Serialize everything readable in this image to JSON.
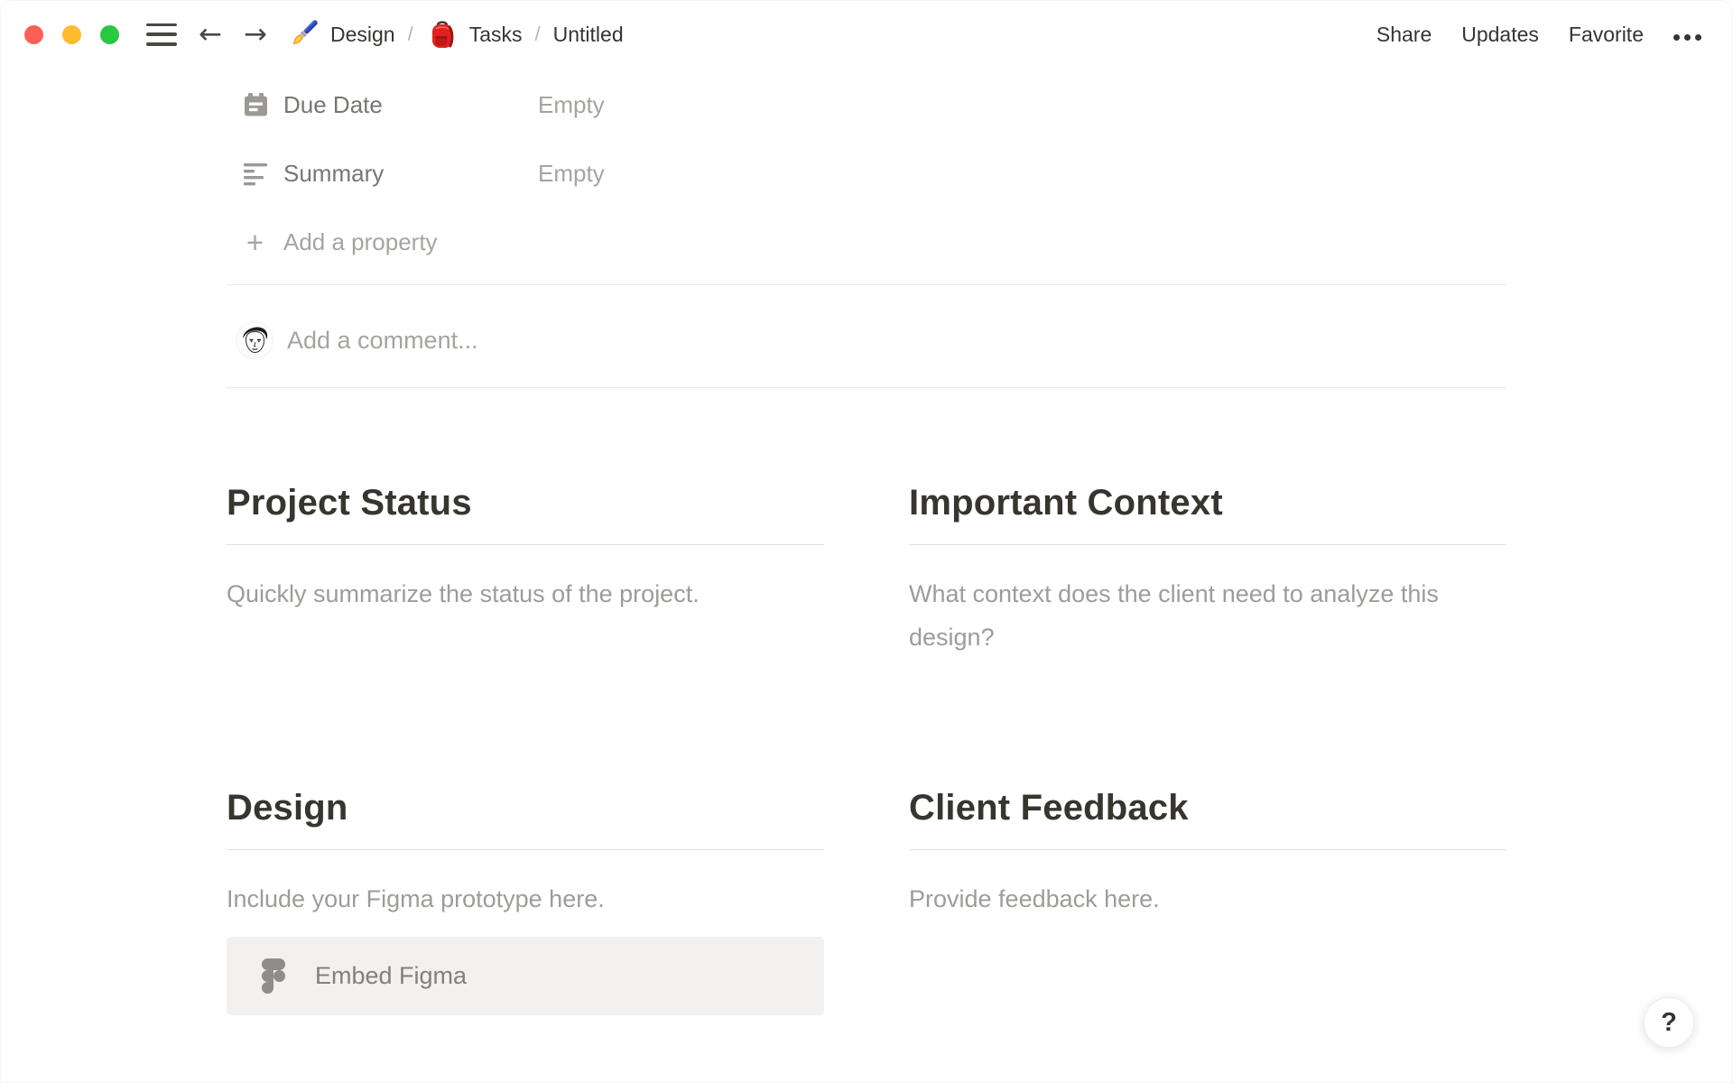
{
  "titlebar": {
    "breadcrumb": {
      "items": [
        {
          "icon": "paintbrush",
          "label": "Design"
        },
        {
          "icon": "red-backpack",
          "label": "Tasks"
        },
        {
          "icon": "none",
          "label": "Untitled"
        }
      ],
      "separator": "/"
    },
    "actions": {
      "share": "Share",
      "updates": "Updates",
      "favorite": "Favorite"
    },
    "icons": {
      "menu": "hamburger-bars",
      "back": "←",
      "forward": "→",
      "more": "three-dots"
    }
  },
  "properties": {
    "rows": [
      {
        "icon": "calendar-icon",
        "name": "Due Date",
        "value": "Empty"
      },
      {
        "icon": "text-align-left-icon",
        "name": "Summary",
        "value": "Empty"
      }
    ],
    "add_property": {
      "icon": "+",
      "label": "Add a property"
    }
  },
  "comment": {
    "avatar_icon": "sketch-face-avatar",
    "placeholder": "Add a comment..."
  },
  "sections": [
    {
      "title": "Project Status",
      "body": "Quickly summarize the status of the project."
    },
    {
      "title": "Important Context",
      "body": "What context does the client need to analyze this design?"
    },
    {
      "title": "Design",
      "body": "Include your Figma prototype here.",
      "embed": {
        "icon": "figma-logo",
        "label": "Embed Figma"
      }
    },
    {
      "title": "Client Feedback",
      "body": "Provide feedback here."
    }
  ],
  "help": {
    "label": "?"
  },
  "colors": {
    "traffic_close": "#ff5f57",
    "traffic_minimize": "#febc2e",
    "traffic_zoom": "#28c840",
    "text_primary": "#37352f",
    "text_property_label": "#787671",
    "text_muted": "#a6a49f",
    "text_body_gray": "#9e9c97",
    "divider": "#ebeae8",
    "embed_background": "#f2f1ef",
    "icon_gray": "#9b9995"
  }
}
